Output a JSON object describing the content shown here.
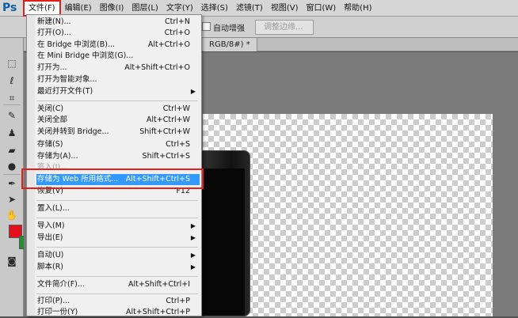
{
  "app": {
    "logo": "Ps",
    "menubar": [
      "文件(F)",
      "编辑(E)",
      "图像(I)",
      "图层(L)",
      "文字(Y)",
      "选择(S)",
      "滤镜(T)",
      "视图(V)",
      "窗口(W)",
      "帮助(H)"
    ]
  },
  "options": {
    "auto_enhance": "自动增强",
    "refine_edge": "调整边缘..."
  },
  "document": {
    "tab": "RGB/8#) *"
  },
  "colors": {
    "foreground": "#e4101c",
    "background": "#1f8f2f",
    "highlight": "#e0201a"
  },
  "file_menu": {
    "items": [
      {
        "label": "新建(N)...",
        "shortcut": "Ctrl+N"
      },
      {
        "label": "打开(O)...",
        "shortcut": "Ctrl+O"
      },
      {
        "label": "在 Bridge 中浏览(B)...",
        "shortcut": "Alt+Ctrl+O"
      },
      {
        "label": "在 Mini Bridge 中浏览(G)...",
        "shortcut": ""
      },
      {
        "label": "打开为...",
        "shortcut": "Alt+Shift+Ctrl+O"
      },
      {
        "label": "打开为智能对象...",
        "shortcut": ""
      },
      {
        "label": "最近打开文件(T)",
        "shortcut": ""
      },
      {
        "label": "关闭(C)",
        "shortcut": "Ctrl+W"
      },
      {
        "label": "关闭全部",
        "shortcut": "Alt+Ctrl+W"
      },
      {
        "label": "关闭并转到 Bridge...",
        "shortcut": "Shift+Ctrl+W"
      },
      {
        "label": "存储(S)",
        "shortcut": "Ctrl+S"
      },
      {
        "label": "存储为(A)...",
        "shortcut": "Shift+Ctrl+S"
      },
      {
        "label": "签入(I)...",
        "shortcut": ""
      },
      {
        "label": "存储为 Web 所用格式...",
        "shortcut": "Alt+Shift+Ctrl+S"
      },
      {
        "label": "恢复(V)",
        "shortcut": "F12"
      },
      {
        "label": "置入(L)...",
        "shortcut": ""
      },
      {
        "label": "导入(M)",
        "shortcut": ""
      },
      {
        "label": "导出(E)",
        "shortcut": ""
      },
      {
        "label": "自动(U)",
        "shortcut": ""
      },
      {
        "label": "脚本(R)",
        "shortcut": ""
      },
      {
        "label": "文件简介(F)...",
        "shortcut": "Alt+Shift+Ctrl+I"
      },
      {
        "label": "打印(P)...",
        "shortcut": "Ctrl+P"
      },
      {
        "label": "打印一份(Y)",
        "shortcut": "Alt+Shift+Ctrl+P"
      }
    ]
  }
}
